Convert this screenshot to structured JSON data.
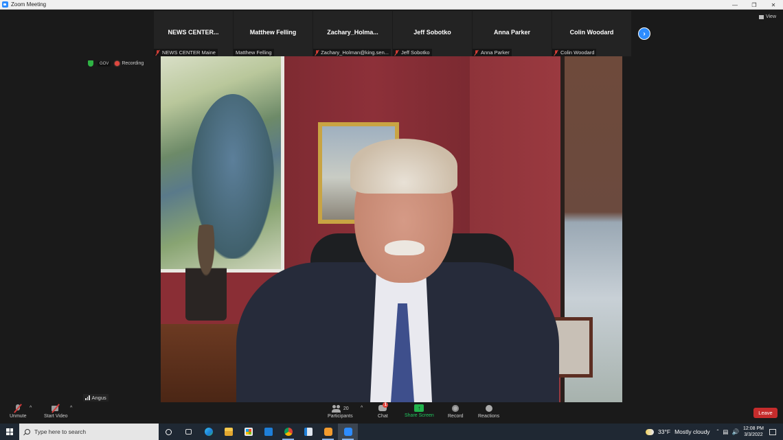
{
  "window": {
    "title": "Zoom Meeting",
    "controls": [
      "minimize",
      "maximize",
      "close"
    ]
  },
  "view_button": {
    "label": "View",
    "icon": "grid-icon"
  },
  "gallery_strip": {
    "tiles": [
      {
        "display_name": "NEWS  CENTER...",
        "label": "NEWS CENTER Maine",
        "muted": true
      },
      {
        "display_name": "Matthew Felling",
        "label": "Matthew Felling",
        "muted": false
      },
      {
        "display_name": "Zachary_Holma...",
        "label": "Zachary_Holman@king.sen...",
        "muted": true
      },
      {
        "display_name": "Jeff Sobotko",
        "label": "Jeff Sobotko",
        "muted": true
      },
      {
        "display_name": "Anna Parker",
        "label": "Anna Parker",
        "muted": true
      },
      {
        "display_name": "Colin Woodard",
        "label": "Colin Woodard",
        "muted": true
      }
    ],
    "next_icon": "chevron-right-icon"
  },
  "meeting_status": {
    "encryption_icon": "shield-icon",
    "badge": "GOV",
    "recording_label": "Recording"
  },
  "active_speaker": {
    "name": "Angus",
    "video_description": "Man in suit seated in office with red walls, painting, bust and window"
  },
  "toolbar": {
    "unmute": "Unmute",
    "start_video": "Start Video",
    "participants": "Participants",
    "participants_count": "20",
    "chat": "Chat",
    "chat_badge": "1",
    "share_screen": "Share Screen",
    "record": "Record",
    "reactions": "Reactions",
    "leave": "Leave"
  },
  "taskbar": {
    "search_placeholder": "Type here to search",
    "apps": [
      "cortana",
      "task-view",
      "edge",
      "file-explorer",
      "microsoft-store",
      "mail",
      "chrome",
      "app-window",
      "phone-app",
      "zoom"
    ],
    "weather_temp": "33°F",
    "weather_desc": "Mostly cloudy",
    "time": "12:08 PM",
    "date": "3/3/2022"
  },
  "colors": {
    "zoom_blue": "#2d8cff",
    "share_green": "#22b24c",
    "leave_red": "#c62c2c",
    "muted_red": "#e0473f"
  }
}
